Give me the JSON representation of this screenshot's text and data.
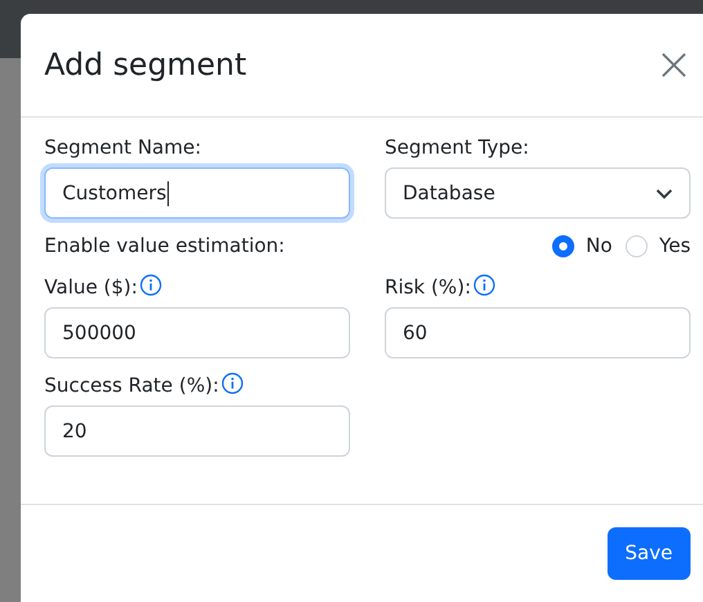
{
  "dialog": {
    "title": "Add segment",
    "fields": [
      {
        "kind": "text",
        "label": "Segment Name:",
        "value": "Customers",
        "focused": true
      },
      {
        "kind": "select",
        "label": "Segment Type:",
        "value": "Database"
      }
    ],
    "estimation": {
      "label": "Enable value estimation:",
      "options": [
        {
          "label": "No",
          "selected": true
        },
        {
          "label": "Yes",
          "selected": false
        }
      ]
    },
    "numbers": [
      {
        "label": "Value ($):",
        "value": "500000"
      },
      {
        "label": "Risk (%):",
        "value": "60"
      },
      {
        "label": "Success Rate (%):",
        "value": "20"
      }
    ],
    "buttons": [
      "Save"
    ]
  }
}
